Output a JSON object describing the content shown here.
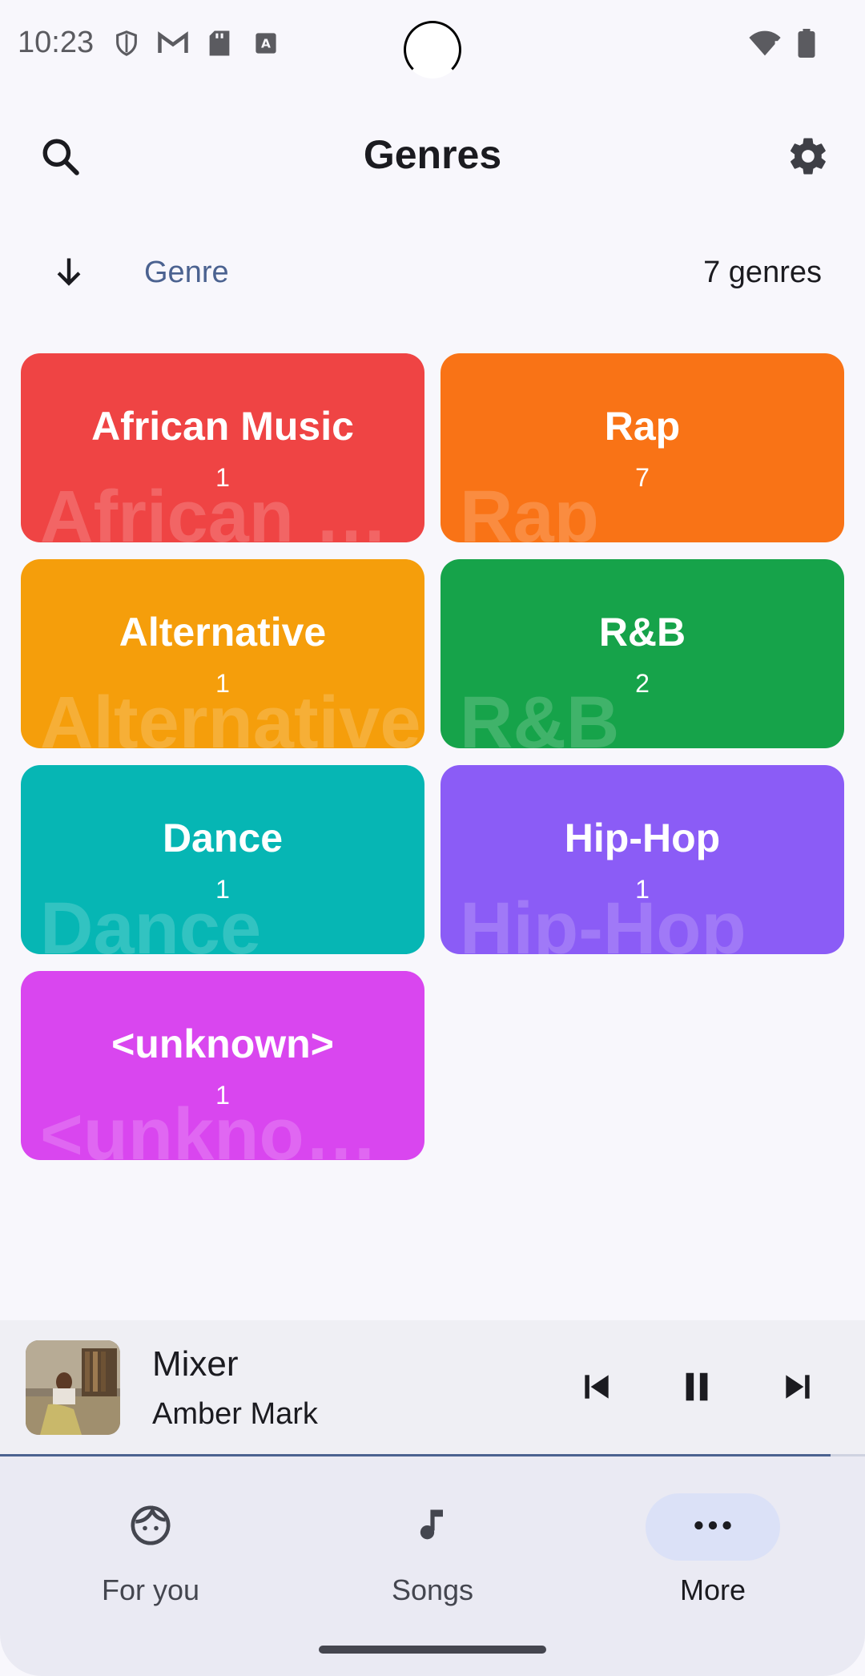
{
  "status_bar": {
    "time": "10:23",
    "icons_left": [
      "shield-icon",
      "gmail-icon",
      "sd-card-icon",
      "font-icon"
    ],
    "icons_right": [
      "wifi-alert-icon",
      "battery-icon"
    ]
  },
  "header": {
    "title": "Genres"
  },
  "sort": {
    "label": "Genre",
    "count": "7 genres"
  },
  "genres": [
    {
      "name": "African Music",
      "count": "1",
      "watermark": "African M...",
      "color": "#ef4444"
    },
    {
      "name": "Rap",
      "count": "7",
      "watermark": "Rap",
      "color": "#f97316"
    },
    {
      "name": "Alternative",
      "count": "1",
      "watermark": "Alternative",
      "color": "#f59e0b"
    },
    {
      "name": "R&B",
      "count": "2",
      "watermark": "R&B",
      "color": "#16a34a"
    },
    {
      "name": "Dance",
      "count": "1",
      "watermark": "Dance",
      "color": "#06b6b4"
    },
    {
      "name": "Hip-Hop",
      "count": "1",
      "watermark": "Hip-Hop",
      "color": "#8b5cf6"
    },
    {
      "name": "<unknown>",
      "count": "1",
      "watermark": "<unknown>",
      "color": "#d946ef"
    }
  ],
  "player": {
    "title": "Mixer",
    "artist": "Amber Mark",
    "progress": 0.96
  },
  "nav": {
    "items": [
      {
        "label": "For you",
        "icon": "face-icon"
      },
      {
        "label": "Songs",
        "icon": "music-note-icon"
      },
      {
        "label": "More",
        "icon": "more-horiz-icon",
        "active": true
      }
    ]
  },
  "colors": {
    "accent": "#4b6290",
    "background": "#f8f7fc",
    "nav_background": "#eaeaf3",
    "nav_active_pill": "#dbe1f7"
  }
}
